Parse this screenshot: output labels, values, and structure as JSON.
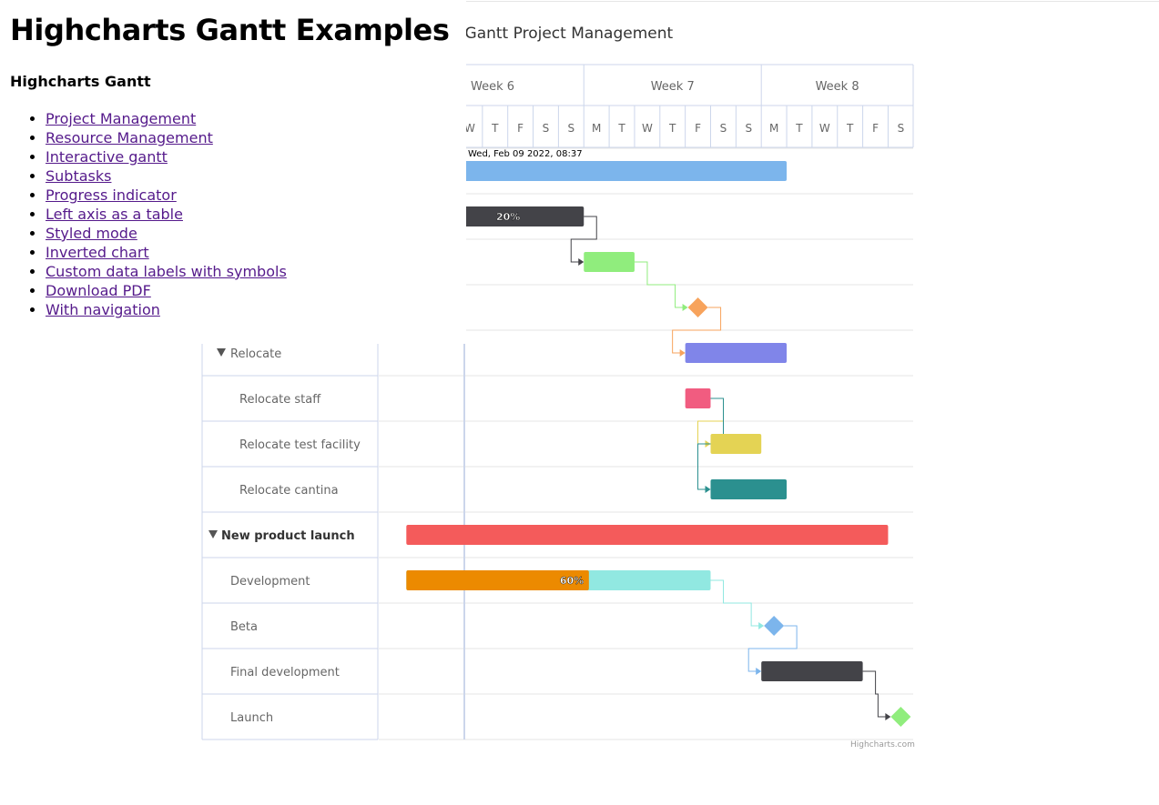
{
  "page": {
    "heading": "Highcharts Gantt Examples",
    "subheading": "Highcharts Gantt",
    "links": [
      "Project Management",
      "Resource Management",
      "Interactive gantt",
      "Subtasks",
      "Progress indicator",
      "Left axis as a table",
      "Styled mode",
      "Inverted chart",
      "Custom data labels with symbols",
      "Download PDF",
      "With navigation"
    ]
  },
  "chart_data": {
    "type": "gantt",
    "title": "Highcharts Gantt Project Management",
    "credits": "Highcharts.com",
    "current_date_label": "Wed, Feb 09 2022, 08:37",
    "weeks": [
      "Week 6",
      "Week 7",
      "Week 8"
    ],
    "days": [
      "W",
      "T",
      "F",
      "S",
      "S",
      "M",
      "T",
      "W",
      "T",
      "F",
      "S",
      "S",
      "M",
      "T",
      "W",
      "T",
      "F",
      "S"
    ],
    "days_start": "2022-02-09",
    "current_date": "2022-02-09",
    "colors": {
      "grid": "#e6e6e6",
      "axis_line": "#ccd6eb",
      "text": "#666666",
      "group_text": "#333333",
      "today_line": "#ccd6eb"
    },
    "rows": [
      {
        "name": "",
        "type": "bar",
        "start": "2022-02-01",
        "end": "2022-02-22",
        "color": "#7cb5ec"
      },
      {
        "name": "",
        "type": "bar",
        "start": "2022-02-01",
        "end": "2022-02-14",
        "color": "#434348",
        "completed": 0.2,
        "completed_label": "20%",
        "dependency": "next"
      },
      {
        "name": "",
        "type": "bar",
        "start": "2022-02-14",
        "end": "2022-02-16",
        "color": "#90ed7d",
        "dependency": "next"
      },
      {
        "name": "",
        "type": "milestone",
        "date": "2022-02-18",
        "color": "#f7a35c",
        "dependency": "next"
      },
      {
        "name": "Relocate",
        "level": 1,
        "collapsible": true,
        "type": "bar",
        "start": "2022-02-18",
        "end": "2022-02-22",
        "color": "#8085e9"
      },
      {
        "name": "Relocate staff",
        "level": 2,
        "type": "bar",
        "start": "2022-02-18",
        "end": "2022-02-19",
        "color": "#f15c80",
        "dependency": "relocate-both"
      },
      {
        "name": "Relocate test facility",
        "level": 2,
        "type": "bar",
        "start": "2022-02-19",
        "end": "2022-02-21",
        "color": "#e4d354"
      },
      {
        "name": "Relocate cantina",
        "level": 2,
        "type": "bar",
        "start": "2022-02-19",
        "end": "2022-02-22",
        "color": "#2b908f"
      },
      {
        "name": "New product launch",
        "level": 0,
        "collapsible": true,
        "bold": true,
        "type": "bar",
        "start": "2022-02-07",
        "end": "2022-02-26",
        "color": "#f45b5b"
      },
      {
        "name": "Development",
        "level": 1,
        "type": "bar",
        "start": "2022-02-07",
        "end": "2022-02-19",
        "color": "#91e8e1",
        "completed": 0.6,
        "completed_color": "#ec8a00",
        "completed_label": "60%",
        "dependency": "next"
      },
      {
        "name": "Beta",
        "level": 1,
        "type": "milestone",
        "date": "2022-02-21",
        "color": "#7cb5ec",
        "dependency": "next"
      },
      {
        "name": "Final development",
        "level": 1,
        "type": "bar",
        "start": "2022-02-21",
        "end": "2022-02-25",
        "color": "#434348",
        "dependency": "next"
      },
      {
        "name": "Launch",
        "level": 1,
        "type": "milestone",
        "date": "2022-02-26",
        "color": "#90ed7d"
      }
    ]
  }
}
